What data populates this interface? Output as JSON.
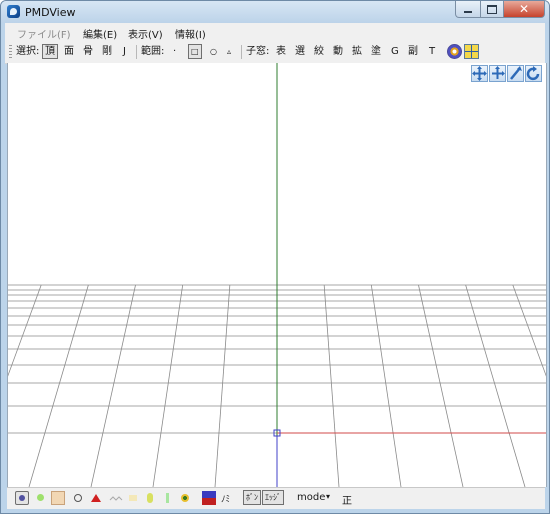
{
  "window": {
    "title": "PMDView"
  },
  "menu": {
    "file": "ファイル(F)",
    "edit": "編集(E)",
    "view": "表示(V)",
    "info": "情報(I)"
  },
  "toolbar": {
    "select_label": "選択:",
    "select_vertex": "頂",
    "select_face": "面",
    "select_bone": "骨",
    "select_rigid": "剛",
    "select_joint": "J",
    "range_label": "範囲:",
    "range_point": "·",
    "range_rect": "□",
    "range_circle": "○",
    "range_free": "▵",
    "child_label": "子窓:",
    "win_table": "表",
    "win_select": "選",
    "win_narrow": "絞",
    "win_move": "動",
    "win_scale": "拡",
    "win_paint": "塗",
    "win_g": "G",
    "win_sub": "副",
    "win_t": "T"
  },
  "bottombar": {
    "mirror_label": "ﾉﾐ",
    "bone_toggle": "ﾎﾞﾝ",
    "edge_toggle": "ｴｯｼﾞ",
    "mode_label": "mode",
    "mode_arrow": "▾",
    "front_label": "正"
  },
  "colors": {
    "axis_green": "#2f7d2f",
    "axis_red": "#d04848",
    "axis_blue": "#4040c8",
    "grid": "#8a8a8a",
    "window_frame": "#bcd4ea"
  },
  "icons": [
    "app-icon",
    "minimize-icon",
    "maximize-icon",
    "close-icon",
    "camera-rotate-icon",
    "grid-toggle-icon",
    "move-icon",
    "pan-icon",
    "zoom-icon",
    "rotate-icon"
  ]
}
